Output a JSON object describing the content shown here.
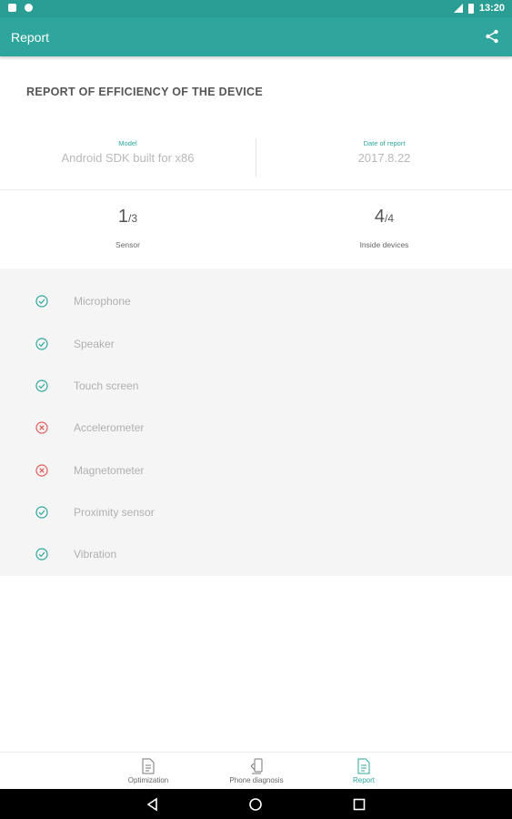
{
  "status_bar": {
    "time": "13:20"
  },
  "app_bar": {
    "title": "Report",
    "share_icon": "share-icon"
  },
  "report": {
    "heading": "REPORT OF EFFICIENCY OF THE DEVICE",
    "model": {
      "label": "Model",
      "value": "Android SDK built for x86"
    },
    "date": {
      "label": "Date of report",
      "value": "2017.8.22"
    },
    "sensor_count": {
      "passed": "1",
      "total": "/3",
      "label": "Sensor"
    },
    "inside_count": {
      "passed": "4",
      "total": "/4",
      "label": "Inside devices"
    }
  },
  "sensors": [
    {
      "name": "Microphone",
      "status": "ok"
    },
    {
      "name": "Speaker",
      "status": "ok"
    },
    {
      "name": "Touch screen",
      "status": "ok"
    },
    {
      "name": "Accelerometer",
      "status": "fail"
    },
    {
      "name": "Magnetometer",
      "status": "fail"
    },
    {
      "name": "Proximity sensor",
      "status": "ok"
    },
    {
      "name": "Vibration",
      "status": "ok"
    }
  ],
  "bottom_nav": {
    "items": [
      {
        "label": "Optimization",
        "icon": "document-icon"
      },
      {
        "label": "Phone diagnosis",
        "icon": "phone-diagnosis-icon"
      },
      {
        "label": "Report",
        "icon": "report-icon",
        "active": true
      }
    ]
  },
  "colors": {
    "primary": "#2ea69d",
    "status_bar": "#2a9d94",
    "ok": "#2ea69d",
    "fail": "#e05a5a"
  }
}
